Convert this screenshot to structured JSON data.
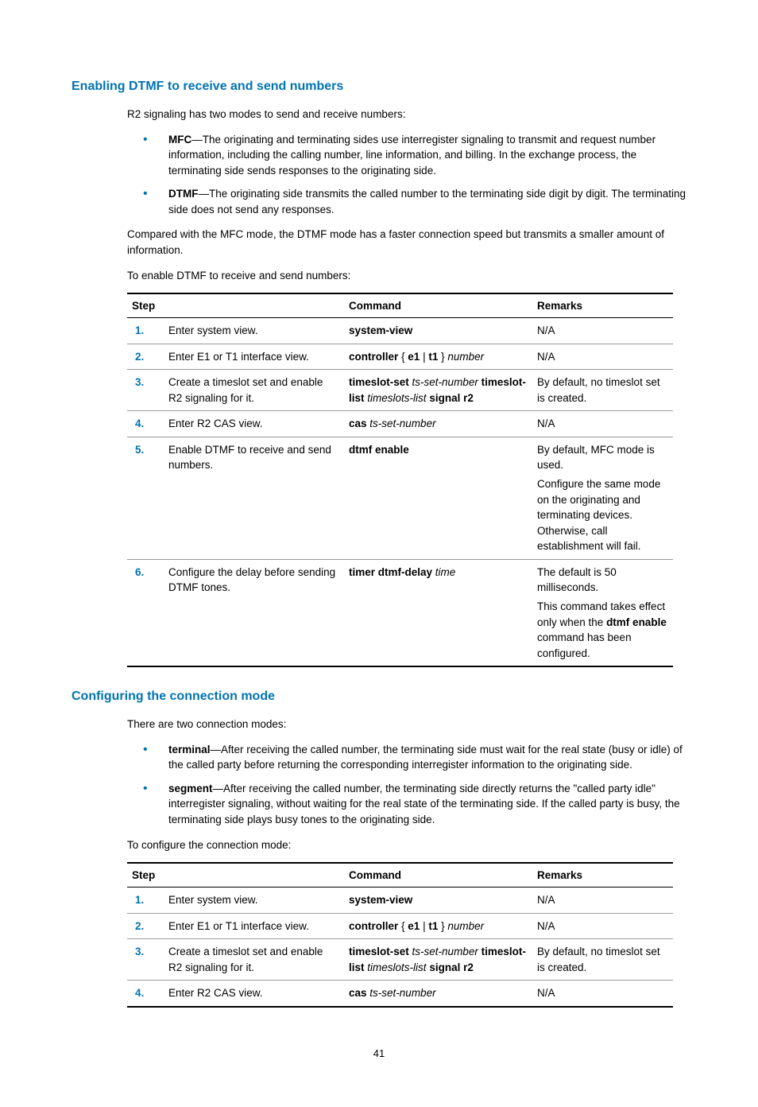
{
  "section1": {
    "heading": "Enabling DTMF to receive and send numbers",
    "intro": "R2 signaling has two modes to send and receive numbers:",
    "bullets": [
      {
        "label": "MFC",
        "text": "—The originating and terminating sides use interregister signaling to transmit and request number information, including the calling number, line information, and billing. In the exchange process, the terminating side sends responses to the originating side."
      },
      {
        "label": "DTMF",
        "text": "—The originating side transmits the called number to the terminating side digit by digit. The terminating side does not send any responses."
      }
    ],
    "compare": "Compared with the MFC mode, the DTMF mode has a faster connection speed but transmits a smaller amount of information.",
    "lead": "To enable DTMF to receive and send numbers:"
  },
  "table1": {
    "headers": {
      "step": "Step",
      "command": "Command",
      "remarks": "Remarks"
    },
    "rows": [
      {
        "num": "1.",
        "step": "Enter system view.",
        "cmd_b1": "system-view",
        "rem": "N/A"
      },
      {
        "num": "2.",
        "step": "Enter E1 or T1 interface view.",
        "cmd_b1": "controller",
        "cmd_t1": " { ",
        "cmd_b2": "e1",
        "cmd_t2": " | ",
        "cmd_b3": "t1",
        "cmd_t3": " } ",
        "cmd_i1": "number",
        "rem": "N/A"
      },
      {
        "num": "3.",
        "step": "Create a timeslot set and enable R2 signaling for it.",
        "cmd_b1": "timeslot-set",
        "cmd_t1": " ",
        "cmd_i1": "ts-set-number",
        "cmd_t2": " ",
        "cmd_b2": "timeslot-list",
        "cmd_t3": " ",
        "cmd_i2": "timeslots-list",
        "cmd_t4": " ",
        "cmd_b3": "signal r2",
        "rem": "By default, no timeslot set is created."
      },
      {
        "num": "4.",
        "step": "Enter R2 CAS view.",
        "cmd_b1": "cas",
        "cmd_t1": " ",
        "cmd_i1": "ts-set-number",
        "rem": "N/A"
      },
      {
        "num": "5.",
        "step": "Enable DTMF to receive and send numbers.",
        "cmd_b1": "dtmf enable",
        "rem1": "By default, MFC mode is used.",
        "rem2": "Configure the same mode on the originating and terminating devices. Otherwise, call establishment will fail."
      },
      {
        "num": "6.",
        "step": "Configure the delay before sending DTMF tones.",
        "cmd_b1": "timer dtmf-delay",
        "cmd_t1": " ",
        "cmd_i1": "time",
        "rem1": "The default is 50 milliseconds.",
        "rem2a": "This command takes effect only when the ",
        "rem2b": "dtmf enable",
        "rem2c": " command has been configured."
      }
    ]
  },
  "section2": {
    "heading": "Configuring the connection mode",
    "intro": "There are two connection modes:",
    "bullets": [
      {
        "label": "terminal",
        "text": "—After receiving the called number, the terminating side must wait for the real state (busy or idle) of the called party before returning the corresponding interregister information to the originating side."
      },
      {
        "label": "segment",
        "text": "—After receiving the called number, the terminating side directly returns the \"called party idle\" interregister signaling, without waiting for the real state of the terminating side. If the called party is busy, the terminating side plays busy tones to the originating side."
      }
    ],
    "lead": "To configure the connection mode:"
  },
  "table2": {
    "headers": {
      "step": "Step",
      "command": "Command",
      "remarks": "Remarks"
    },
    "rows": [
      {
        "num": "1.",
        "step": "Enter system view.",
        "cmd_b1": "system-view",
        "rem": "N/A"
      },
      {
        "num": "2.",
        "step": "Enter E1 or T1 interface view.",
        "cmd_b1": "controller",
        "cmd_t1": " { ",
        "cmd_b2": "e1",
        "cmd_t2": " | ",
        "cmd_b3": "t1",
        "cmd_t3": " } ",
        "cmd_i1": "number",
        "rem": "N/A"
      },
      {
        "num": "3.",
        "step": "Create a timeslot set and enable R2 signaling for it.",
        "cmd_b1": "timeslot-set",
        "cmd_t1": " ",
        "cmd_i1": "ts-set-number",
        "cmd_t2": " ",
        "cmd_b2": "timeslot-list",
        "cmd_t3": " ",
        "cmd_i2": "timeslots-list",
        "cmd_t4": " ",
        "cmd_b3": "signal r2",
        "rem": "By default, no timeslot set is created."
      },
      {
        "num": "4.",
        "step": "Enter R2 CAS view.",
        "cmd_b1": "cas",
        "cmd_t1": " ",
        "cmd_i1": "ts-set-number",
        "rem": "N/A"
      }
    ]
  },
  "pageNum": "41"
}
